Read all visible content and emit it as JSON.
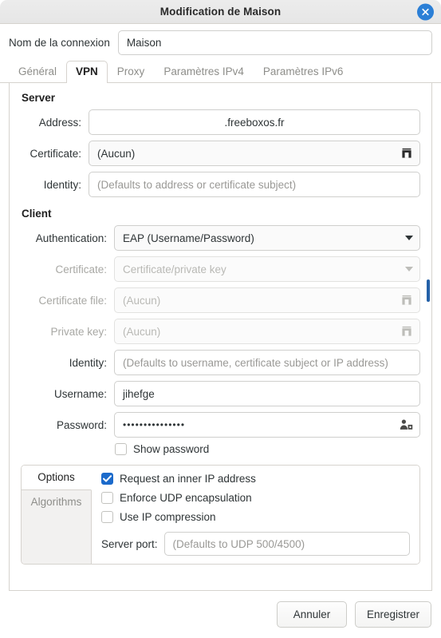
{
  "window": {
    "title": "Modification de Maison",
    "close_icon": "close-icon"
  },
  "connection": {
    "label": "Nom de la connexion",
    "value": "Maison"
  },
  "tabs": [
    {
      "label": "Général",
      "active": false
    },
    {
      "label": "VPN",
      "active": true
    },
    {
      "label": "Proxy",
      "active": false
    },
    {
      "label": "Paramètres IPv4",
      "active": false
    },
    {
      "label": "Paramètres IPv6",
      "active": false
    }
  ],
  "server": {
    "title": "Server",
    "address": {
      "label": "Address:",
      "value": ".freeboxos.fr"
    },
    "certificate": {
      "label": "Certificate:",
      "value": "(Aucun)",
      "icon": "file-picker-icon"
    },
    "identity": {
      "label": "Identity:",
      "placeholder": "(Defaults to address or certificate subject)"
    }
  },
  "client": {
    "title": "Client",
    "authentication": {
      "label": "Authentication:",
      "value": "EAP (Username/Password)",
      "icon": "chevron-down-icon"
    },
    "certificate": {
      "label": "Certificate:",
      "value": "Certificate/private key",
      "icon": "chevron-down-icon",
      "disabled": true
    },
    "certificate_file": {
      "label": "Certificate file:",
      "value": "(Aucun)",
      "icon": "file-picker-icon",
      "disabled": true
    },
    "private_key": {
      "label": "Private key:",
      "value": "(Aucun)",
      "icon": "file-picker-icon",
      "disabled": true
    },
    "identity": {
      "label": "Identity:",
      "placeholder": "(Defaults to username, certificate subject or IP address)"
    },
    "username": {
      "label": "Username:",
      "value": "jihefge"
    },
    "password": {
      "label": "Password:",
      "value": "•••••••••••••••",
      "icon": "password-store-icon"
    },
    "show_password": {
      "label": "Show password",
      "checked": false
    }
  },
  "options_notebook": {
    "vtabs": [
      {
        "label": "Options",
        "active": true
      },
      {
        "label": "Algorithms",
        "active": false
      }
    ],
    "checkboxes": [
      {
        "label": "Request an inner IP address",
        "checked": true
      },
      {
        "label": "Enforce UDP encapsulation",
        "checked": false
      },
      {
        "label": "Use IP compression",
        "checked": false
      }
    ],
    "server_port": {
      "label": "Server port:",
      "placeholder": "(Defaults to UDP 500/4500)"
    }
  },
  "footer": {
    "cancel": "Annuler",
    "save": "Enregistrer"
  },
  "colors": {
    "accent": "#1b6acb",
    "close_button": "#2b7fd6",
    "scrollbar": "#2461a8"
  }
}
